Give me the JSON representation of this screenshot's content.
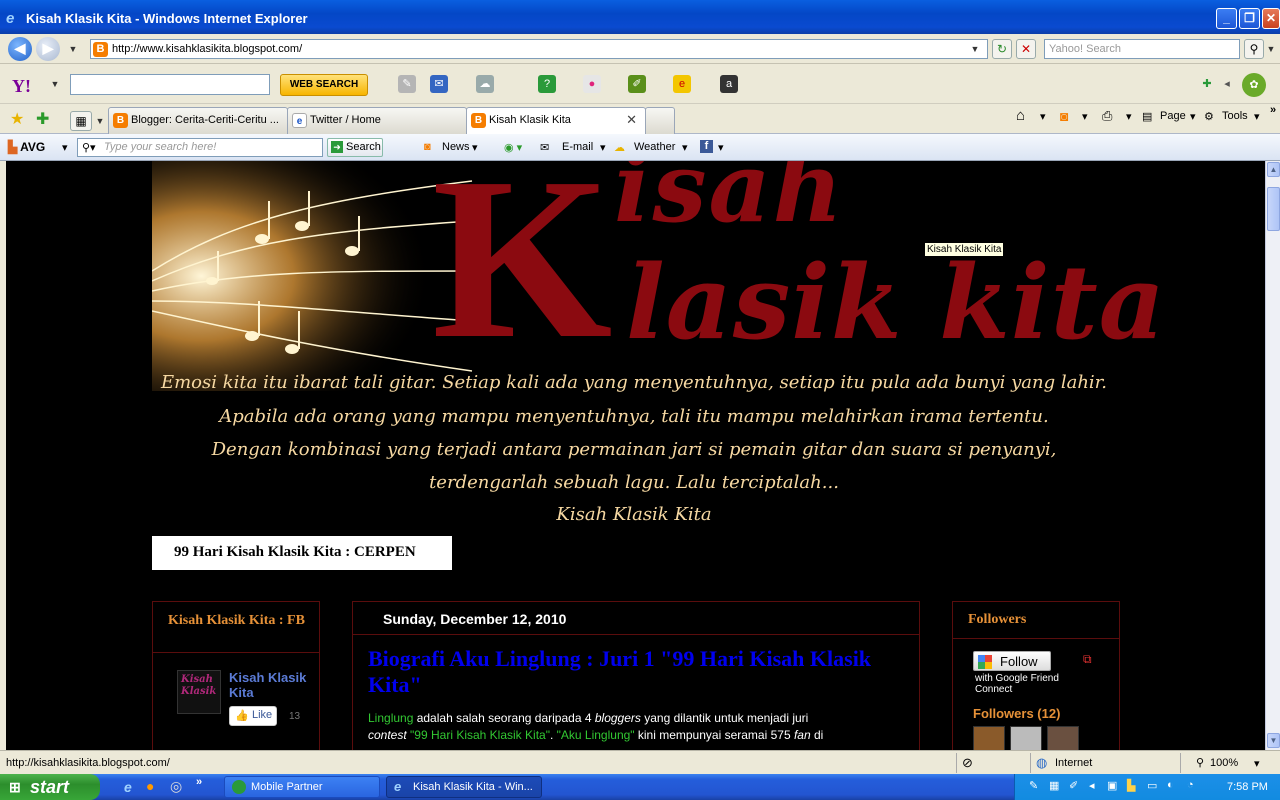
{
  "window": {
    "title": "Kisah Klasik Kita - Windows Internet Explorer"
  },
  "address": {
    "url": "http://www.kisahklasikita.blogspot.com/",
    "search_placeholder": "Yahoo! Search"
  },
  "yahoo_toolbar": {
    "web_search_label": "WEB SEARCH"
  },
  "tabs": [
    {
      "label": "Blogger: Cerita-Ceriti-Ceritu ..."
    },
    {
      "label": "Twitter / Home"
    },
    {
      "label": "Kisah Klasik Kita"
    }
  ],
  "command_bar": {
    "page_label": "Page",
    "tools_label": "Tools"
  },
  "avg_toolbar": {
    "logo": "AVG",
    "search_placeholder": "Type your search here!",
    "search_button": "Search",
    "news": "News",
    "email": "E-mail",
    "weather": "Weather"
  },
  "page": {
    "header_big_letter": "K",
    "header_word1": "isah",
    "header_word2": "lasik kita",
    "tooltip": "Kisah Klasik Kita",
    "poem": [
      "Emosi kita itu ibarat tali gitar. Setiap kali ada yang menyentuhnya, setiap itu pula ada bunyi yang lahir.",
      "Apabila ada orang yang mampu menyentuhnya, tali itu mampu melahirkan irama tertentu.",
      "Dengan kombinasi yang terjadi antara permainan jari si pemain gitar dan suara si penyanyi,",
      "terdengarlah sebuah lagu. Lalu terciptalah...",
      "Kisah Klasik Kita"
    ],
    "cerpen_tab": "99 Hari Kisah Klasik Kita : CERPEN",
    "fb_box": {
      "title": "Kisah Klasik Kita : FB",
      "page_name": "Kisah Klasik Kita",
      "like_label": "Like",
      "like_count": "13",
      "thumb_text": "Kisah Klasik"
    },
    "post": {
      "date": "Sunday, December 12, 2010",
      "title": "Biografi Aku Linglung : Juri 1 \"99 Hari Kisah Klasik Kita\"",
      "body_1": "Linglung",
      "body_2": " adalah salah seorang daripada 4 ",
      "body_3": "bloggers",
      "body_4": " yang dilantik untuk menjadi juri ",
      "body_5": "contest",
      "body_6": "\"99 Hari Kisah Klasik Kita\"",
      "body_7": "\"Aku Linglung\"",
      "body_8": " kini mempunyai seramai 575 ",
      "body_9": "fan",
      "body_10": " di"
    },
    "followers_box": {
      "title": "Followers",
      "follow_label": "Follow",
      "gfc_text": "with Google Friend Connect",
      "followers_count": "Followers (12)"
    }
  },
  "status_bar": {
    "url": "http://kisahklasikita.blogspot.com/",
    "zone": "Internet",
    "zoom": "100%"
  },
  "taskbar": {
    "start": "start",
    "items": [
      "Mobile Partner",
      "Kisah Klasik Kita - Win..."
    ],
    "clock": "7:58 PM"
  }
}
